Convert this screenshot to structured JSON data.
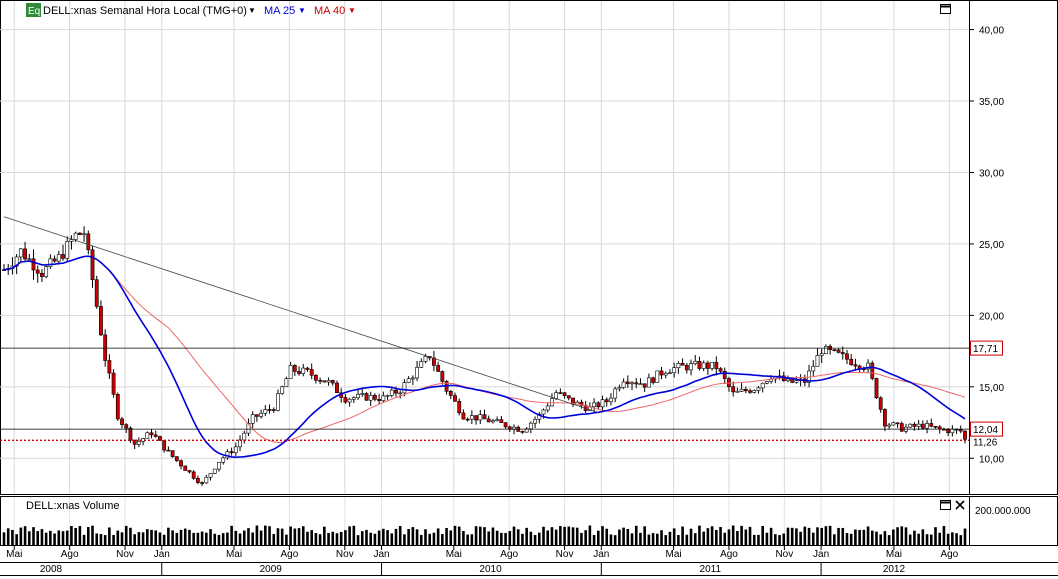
{
  "header": {
    "eq_badge": "Eq",
    "symbol_label": "DELL:xnas Semanal Hora Local (TMG+0)",
    "ma25_label": "MA 25",
    "ma40_label": "MA 40"
  },
  "volume_panel": {
    "label": "DELL:xnas Volume",
    "axis_label": "200.000.000",
    "scale_ref": 200000000
  },
  "colors": {
    "candle_up": "#ffffff",
    "candle_down": "#cc0000",
    "ma25": "#0000dd",
    "ma40": "#ee6666",
    "support_dotted": "#cc0000",
    "badge_green": "#2e8b3a",
    "price_tag_border": "#cc0000"
  },
  "chart_data": {
    "type": "candlestick",
    "x_range": [
      "2008-04-14",
      "2012-08-27"
    ],
    "ylim": [
      7.5,
      42.0
    ],
    "y_ticks": [
      "10,00",
      "15,00",
      "20,00",
      "25,00",
      "30,00",
      "35,00",
      "40,00"
    ],
    "y_tick_values": [
      10,
      15,
      20,
      25,
      30,
      35,
      40
    ],
    "month_ticks": [
      {
        "label": "Mai",
        "date": "2008-05-01"
      },
      {
        "label": "Ago",
        "date": "2008-08-01"
      },
      {
        "label": "Nov",
        "date": "2008-11-01"
      },
      {
        "label": "Jan",
        "date": "2009-01-01"
      },
      {
        "label": "Mai",
        "date": "2009-05-01"
      },
      {
        "label": "Ago",
        "date": "2009-08-01"
      },
      {
        "label": "Nov",
        "date": "2009-11-01"
      },
      {
        "label": "Jan",
        "date": "2010-01-01"
      },
      {
        "label": "Mai",
        "date": "2010-05-01"
      },
      {
        "label": "Ago",
        "date": "2010-08-01"
      },
      {
        "label": "Nov",
        "date": "2010-11-01"
      },
      {
        "label": "Jan",
        "date": "2011-01-01"
      },
      {
        "label": "Mai",
        "date": "2011-05-01"
      },
      {
        "label": "Ago",
        "date": "2011-08-01"
      },
      {
        "label": "Nov",
        "date": "2011-11-01"
      },
      {
        "label": "Jan",
        "date": "2012-01-01"
      },
      {
        "label": "Mai",
        "date": "2012-05-01"
      },
      {
        "label": "Ago",
        "date": "2012-08-01"
      }
    ],
    "year_ticks": [
      {
        "label": "2008",
        "date": "2008-07-01"
      },
      {
        "label": "2009",
        "date": "2009-07-01"
      },
      {
        "label": "2010",
        "date": "2010-07-01"
      },
      {
        "label": "2011",
        "date": "2011-07-01"
      },
      {
        "label": "2012",
        "date": "2012-05-01"
      }
    ],
    "year_boundaries": [
      "2009-01-01",
      "2010-01-01",
      "2011-01-01",
      "2012-01-01"
    ],
    "price_anchors": [
      [
        "2008-04-14",
        23.2
      ],
      [
        "2008-05-12",
        24.5
      ],
      [
        "2008-06-16",
        23.0
      ],
      [
        "2008-07-14",
        24.0
      ],
      [
        "2008-08-11",
        25.6
      ],
      [
        "2008-08-25",
        25.8
      ],
      [
        "2008-09-08",
        22.5
      ],
      [
        "2008-09-29",
        17.0
      ],
      [
        "2008-10-20",
        13.0
      ],
      [
        "2008-11-17",
        11.0
      ],
      [
        "2008-12-15",
        11.8
      ],
      [
        "2009-01-12",
        10.4
      ],
      [
        "2009-02-16",
        9.0
      ],
      [
        "2009-03-09",
        8.2
      ],
      [
        "2009-04-06",
        9.8
      ],
      [
        "2009-05-04",
        10.8
      ],
      [
        "2009-06-01",
        12.8
      ],
      [
        "2009-07-06",
        13.6
      ],
      [
        "2009-08-03",
        16.2
      ],
      [
        "2009-08-31",
        16.0
      ],
      [
        "2009-10-05",
        15.3
      ],
      [
        "2009-11-02",
        14.2
      ],
      [
        "2009-12-07",
        14.3
      ],
      [
        "2010-01-04",
        14.2
      ],
      [
        "2010-02-01",
        14.8
      ],
      [
        "2010-03-01",
        16.2
      ],
      [
        "2010-03-22",
        17.2
      ],
      [
        "2010-04-19",
        14.8
      ],
      [
        "2010-05-17",
        13.0
      ],
      [
        "2010-06-14",
        12.8
      ],
      [
        "2010-07-19",
        12.4
      ],
      [
        "2010-08-23",
        12.0
      ],
      [
        "2010-09-20",
        13.0
      ],
      [
        "2010-10-18",
        14.6
      ],
      [
        "2010-11-15",
        13.9
      ],
      [
        "2010-12-13",
        13.5
      ],
      [
        "2011-01-10",
        14.0
      ],
      [
        "2011-02-07",
        15.6
      ],
      [
        "2011-03-14",
        15.2
      ],
      [
        "2011-04-18",
        16.2
      ],
      [
        "2011-05-16",
        16.4
      ],
      [
        "2011-06-13",
        16.5
      ],
      [
        "2011-07-11",
        16.4
      ],
      [
        "2011-08-08",
        14.5
      ],
      [
        "2011-09-12",
        14.9
      ],
      [
        "2011-10-10",
        15.8
      ],
      [
        "2011-11-07",
        15.3
      ],
      [
        "2011-12-05",
        15.4
      ],
      [
        "2012-01-02",
        17.6
      ],
      [
        "2012-01-30",
        17.2
      ],
      [
        "2012-02-27",
        16.7
      ],
      [
        "2012-03-19",
        16.4
      ],
      [
        "2012-04-16",
        12.5
      ],
      [
        "2012-05-14",
        12.1
      ],
      [
        "2012-06-18",
        12.3
      ],
      [
        "2012-07-16",
        12.0
      ],
      [
        "2012-08-20",
        11.9
      ],
      [
        "2012-08-27",
        11.3
      ]
    ],
    "ma25_label": "MA 25",
    "ma40_label": "MA 40",
    "trendline": {
      "start": [
        "2008-04-14",
        26.9
      ],
      "end": [
        "2010-12-27",
        13.2
      ]
    },
    "resistance_level": 17.71,
    "resistance_tag": "17,71",
    "support_level": 12.04,
    "support_tag": "12,04",
    "last_price": 11.26,
    "last_price_tag": "11,26",
    "volume_typical_millions": [
      50,
      100
    ]
  }
}
